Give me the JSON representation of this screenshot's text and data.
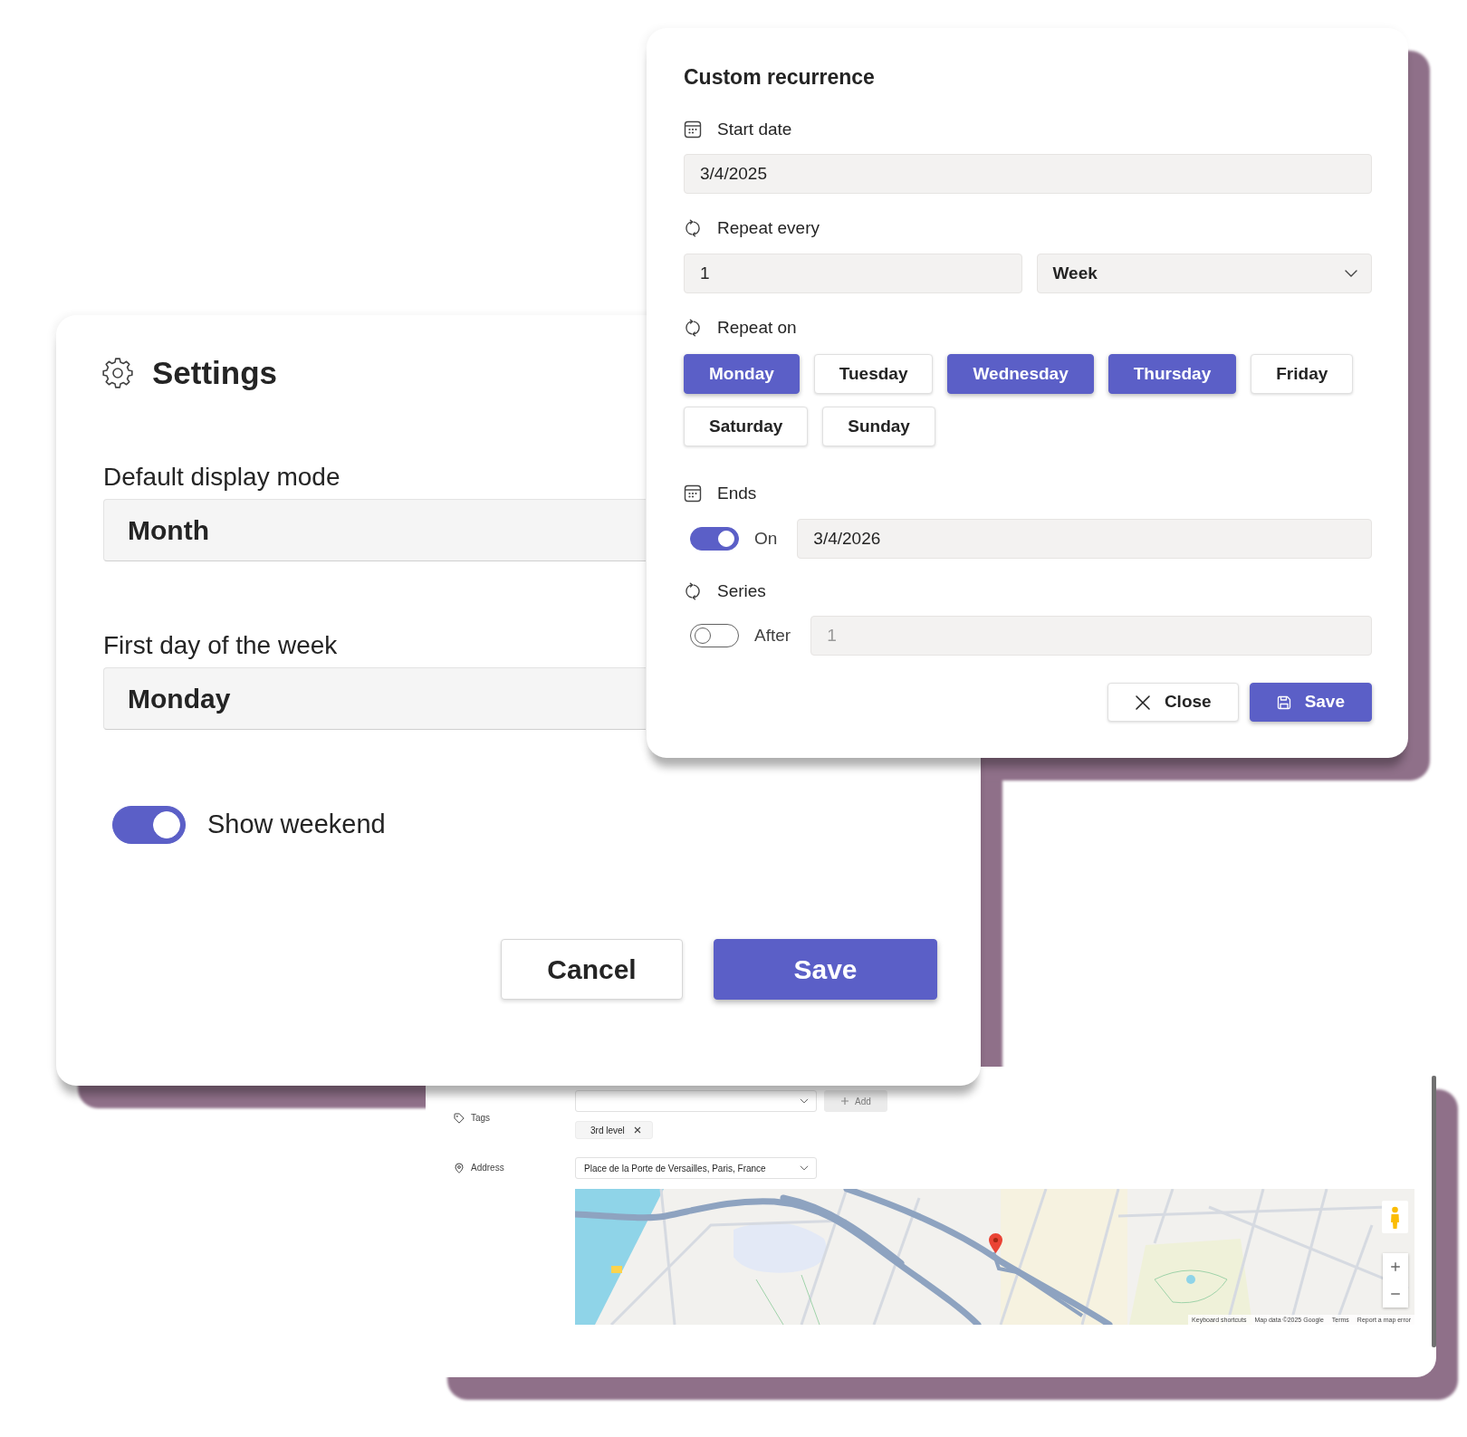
{
  "custom_recurrence": {
    "title": "Custom recurrence",
    "start_date": {
      "label": "Start date",
      "value": "3/4/2025"
    },
    "repeat_every": {
      "label": "Repeat every",
      "interval": "1",
      "unit": "Week"
    },
    "repeat_on": {
      "label": "Repeat on",
      "days": [
        {
          "label": "Monday",
          "selected": true
        },
        {
          "label": "Tuesday",
          "selected": false
        },
        {
          "label": "Wednesday",
          "selected": true
        },
        {
          "label": "Thursday",
          "selected": true
        },
        {
          "label": "Friday",
          "selected": false
        },
        {
          "label": "Saturday",
          "selected": false
        },
        {
          "label": "Sunday",
          "selected": false
        }
      ]
    },
    "ends": {
      "label": "Ends",
      "switch": {
        "label": "On",
        "on": true
      },
      "date": "3/4/2026"
    },
    "series": {
      "label": "Series",
      "switch": {
        "label": "After",
        "on": false
      },
      "count": "1"
    },
    "buttons": [
      {
        "label": "Close",
        "kind": "secondary"
      },
      {
        "label": "Save",
        "kind": "primary"
      }
    ]
  },
  "settings": {
    "title": "Settings",
    "fields": [
      {
        "label": "Default display mode",
        "value": "Month"
      },
      {
        "label": "First day of the week",
        "value": "Monday"
      }
    ],
    "show_weekend": {
      "label": "Show weekend",
      "on": true
    },
    "buttons": [
      {
        "label": "Cancel",
        "kind": "secondary"
      },
      {
        "label": "Save",
        "kind": "primary"
      }
    ]
  },
  "event_form": {
    "tags": {
      "label": "Tags",
      "add_button": {
        "label": "Add",
        "disabled": true
      },
      "chips": [
        {
          "label": "3rd level"
        }
      ]
    },
    "address": {
      "label": "Address",
      "value": "Place de la Porte de Versailles, Paris, France"
    },
    "map": {
      "attribution": [
        "Keyboard shortcuts",
        "Map data ©2025 Google",
        "Terms",
        "Report a map error"
      ]
    }
  }
}
